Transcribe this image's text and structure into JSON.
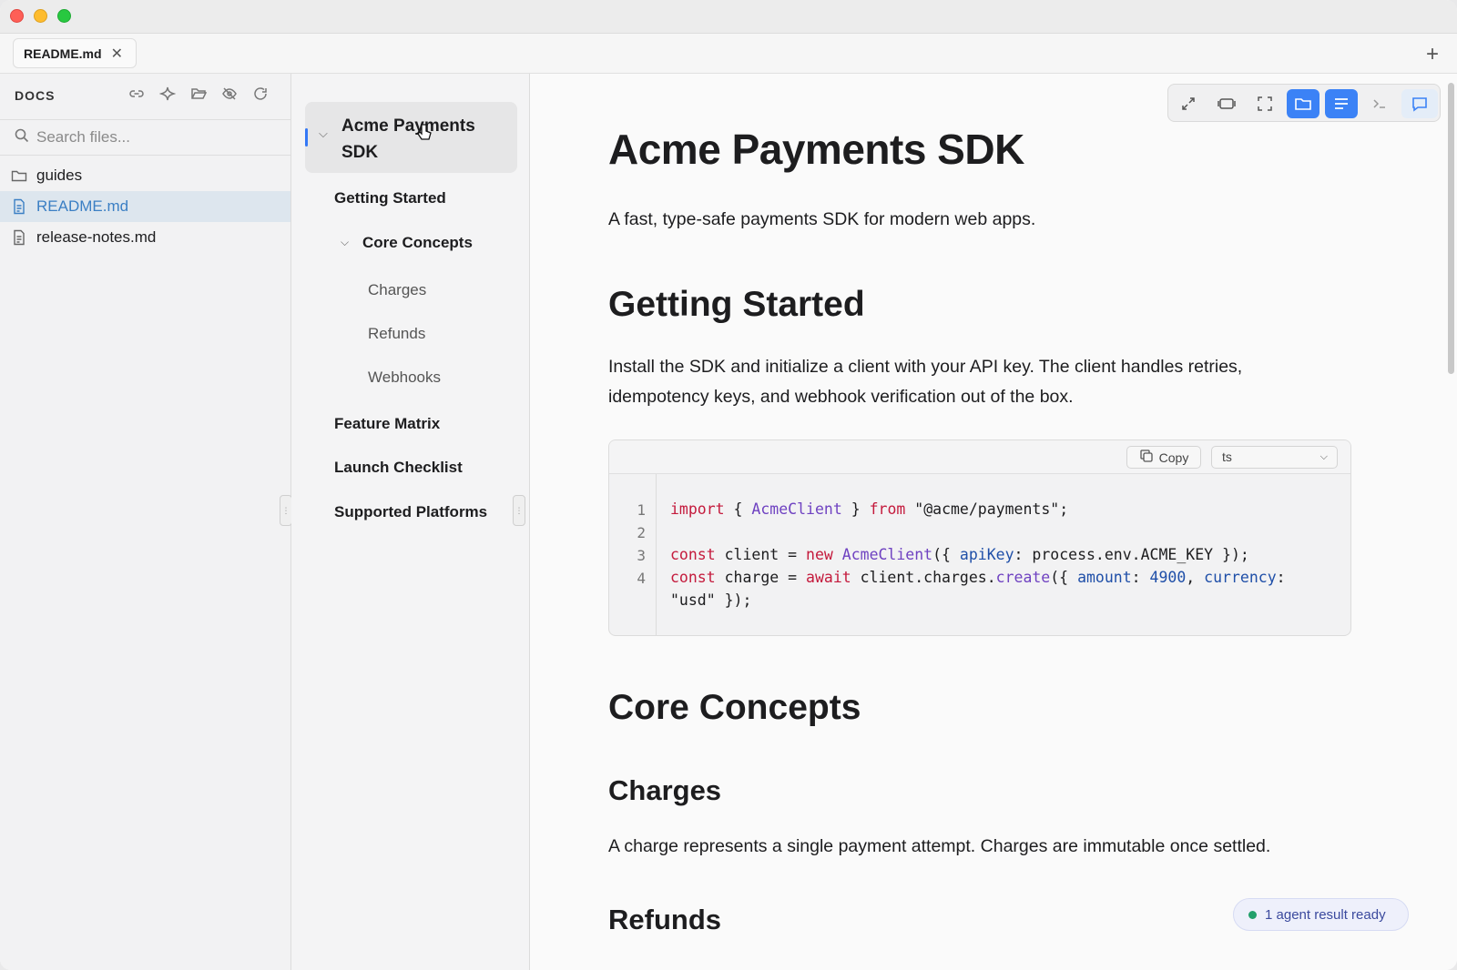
{
  "tab": {
    "title": "README.md"
  },
  "sidebar": {
    "header": "DOCS",
    "search_placeholder": "Search files...",
    "files": [
      {
        "name": "guides",
        "type": "folder"
      },
      {
        "name": "README.md",
        "type": "file",
        "active": true
      },
      {
        "name": "release-notes.md",
        "type": "file"
      }
    ]
  },
  "outline": {
    "title_line1": "Acme Payments",
    "title_line2": "SDK",
    "items": [
      "Getting Started",
      "Core Concepts",
      "Charges",
      "Refunds",
      "Webhooks",
      "Feature Matrix",
      "Launch Checklist",
      "Supported Platforms"
    ]
  },
  "doc": {
    "title": "Acme Payments SDK",
    "subtitle": "A fast, type-safe payments SDK for modern web apps.",
    "getting_started": {
      "heading": "Getting Started",
      "line1": "Install the SDK and initialize a client with your API key. The client handles retries,",
      "line2": "idempotency keys, and webhook verification out of the box."
    },
    "code": {
      "copy_label": "Copy",
      "language": "ts",
      "line_numbers": [
        "1",
        "2",
        "3",
        "4"
      ]
    },
    "core_concepts": {
      "heading": "Core Concepts"
    },
    "charges": {
      "heading": "Charges",
      "text": "A charge represents a single payment attempt. Charges are immutable once settled."
    },
    "refunds": {
      "heading": "Refunds"
    }
  },
  "status": {
    "agent_label": "1 agent result ready"
  },
  "colors": {
    "accent": "#3b82f6",
    "active_file": "#3b7fc4",
    "keyword": "#c41a3c",
    "type": "#6f42c1"
  }
}
